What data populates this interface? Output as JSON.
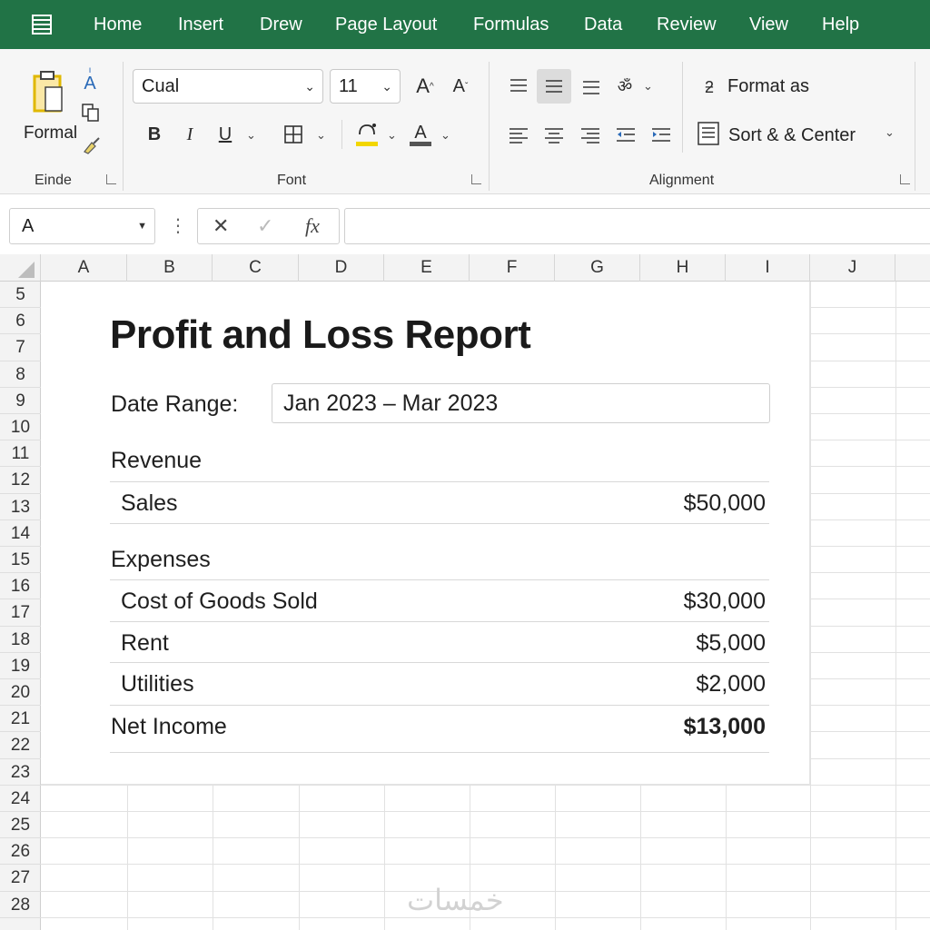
{
  "menu": {
    "tabs": [
      "Home",
      "Insert",
      "Drew",
      "Page Layout",
      "Formulas",
      "Data",
      "Review",
      "View",
      "Help"
    ]
  },
  "ribbon": {
    "clipboard": {
      "paste_label": "Formal",
      "group_label": "Einde"
    },
    "font": {
      "font_name": "Cual",
      "font_size": "11",
      "bold": "B",
      "italic": "I",
      "underline": "U",
      "font_color_letter": "A",
      "increase_size": "A",
      "decrease_size": "A",
      "small_a": "A",
      "group_label": "Font",
      "highlight_color": "#f2d600",
      "font_color": "#c0392b"
    },
    "alignment": {
      "format_as": "Format as",
      "sort_center": "Sort & & Center",
      "group_label": "Alignment"
    }
  },
  "formula_bar": {
    "name_box": "A",
    "cancel": "✕",
    "enter": "✓",
    "fx": "fx",
    "formula": ""
  },
  "sheet": {
    "columns": [
      "A",
      "B",
      "C",
      "D",
      "E",
      "F",
      "G",
      "H",
      "I",
      "J"
    ],
    "rows": [
      "5",
      "6",
      "7",
      "8",
      "9",
      "10",
      "11",
      "12",
      "13",
      "14",
      "15",
      "16",
      "17",
      "18",
      "19",
      "20",
      "21",
      "22",
      "23",
      "24",
      "25",
      "26",
      "27",
      "28"
    ]
  },
  "report": {
    "title": "Profit and Loss Report",
    "date_label": "Date Range:",
    "date_value": "Jan 2023 – Mar 2023",
    "revenue_heading": "Revenue",
    "revenue": [
      {
        "label": "Sales",
        "amount": "$50,000"
      }
    ],
    "expenses_heading": "Expenses",
    "expenses": [
      {
        "label": "Cost of Goods Sold",
        "amount": "$30,000"
      },
      {
        "label": "Rent",
        "amount": "$5,000"
      },
      {
        "label": "Utilities",
        "amount": "$2,000"
      }
    ],
    "net_income": {
      "label": "Net Income",
      "amount": "$13,000"
    }
  },
  "watermark": "خمسات",
  "colors": {
    "brand_green": "#217346",
    "ribbon_bg": "#f6f6f6",
    "grid_line": "#e1e1e1"
  }
}
